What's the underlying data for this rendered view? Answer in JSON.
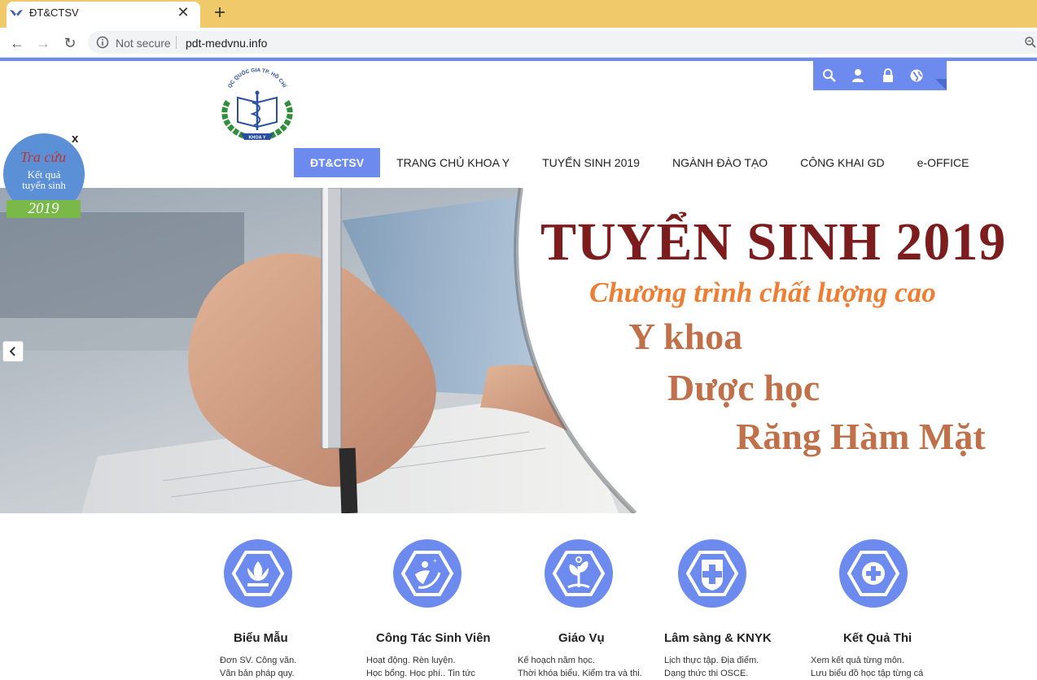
{
  "browser": {
    "tab_title": "ĐT&CTSV",
    "tab_close": "✕",
    "new_tab": "+",
    "back": "←",
    "forward": "→",
    "reload": "↻",
    "security_label": "Not secure",
    "url": "pdt-medvnu.info"
  },
  "header": {
    "logo_text_top": "ĐẠI HỌC QUỐC GIA TP. HỒ CHÍ MINH",
    "logo_text_bottom": "KHOA Y",
    "utility_icons": [
      "search-icon",
      "user-icon",
      "lock-icon",
      "globe-icon"
    ]
  },
  "nav": {
    "items": [
      "ĐT&CTSV",
      "TRANG CHỦ KHOA Y",
      "TUYỂN SINH 2019",
      "NGÀNH ĐÀO TẠO",
      "CÔNG KHAI GD",
      "e-OFFICE"
    ],
    "active_index": 0
  },
  "hero": {
    "title": "TUYỂN SINH 2019",
    "subtitle": "Chương trình chất lượng cao",
    "programs": [
      "Y khoa",
      "Dược học",
      "Răng Hàm Mặt"
    ],
    "prev_icon": "‹"
  },
  "float_widget": {
    "close": "x",
    "line1": "Tra cứu",
    "line2": "Kết quả",
    "line3": "tuyển sinh",
    "year": "2019"
  },
  "cards": [
    {
      "title": "Biểu Mẫu",
      "icon": "lotus-icon",
      "lines": [
        "Đơn SV. Công văn.",
        "Văn bản pháp quy."
      ]
    },
    {
      "title": "Công Tác Sinh Viên",
      "icon": "student-icon",
      "lines": [
        "Hoạt động. Rèn luyện.",
        "Học  bổng.  Học  phí..  Tin  tức"
      ]
    },
    {
      "title": "Giáo Vụ",
      "icon": "sprout-icon",
      "lines": [
        "Kế hoạch năm học.",
        "Thời khóa biểu. Kiểm tra và thi."
      ]
    },
    {
      "title": "Lâm sàng & KNYK",
      "icon": "medical-cross-icon",
      "lines": [
        "Lịch thực tập. Địa điểm.",
        "Dạng thức thi OSCE."
      ]
    },
    {
      "title": "Kết Quả Thi",
      "icon": "plus-icon",
      "lines": [
        "Xem kết quả từng môn.",
        "Lưu  biểu  đồ  học  tập  từng  cá"
      ]
    }
  ],
  "colors": {
    "tab_bar": "#f0c96a",
    "accent": "#6d8bef",
    "hero_title": "#7c1c1c",
    "hero_subtitle": "#ef7d32",
    "hero_programs": "#c0714a"
  }
}
